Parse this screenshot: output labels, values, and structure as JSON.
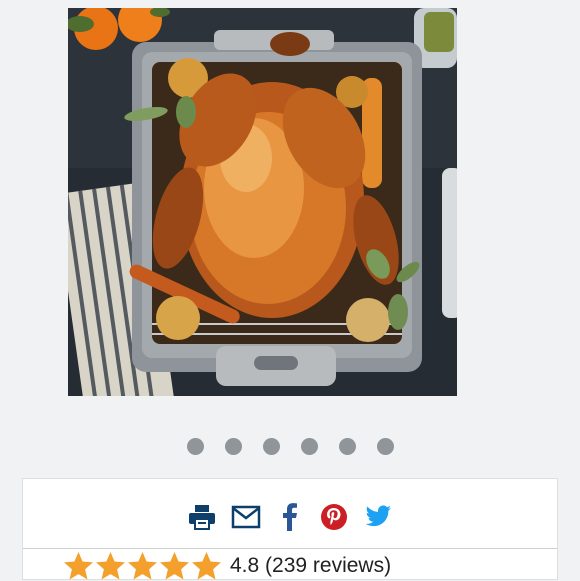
{
  "photo": {
    "alt": "Roasted turkey with vegetables in a roasting pan"
  },
  "carousel": {
    "dot_count": 6,
    "dot_color": "#8f9598"
  },
  "share": {
    "icons": [
      "print-icon",
      "email-icon",
      "facebook-icon",
      "pinterest-icon",
      "twitter-icon"
    ],
    "colors": {
      "print": "#0e3f6b",
      "email": "#0e3f6b",
      "facebook": "#2b5796",
      "pinterest": "#cc1f25",
      "twitter": "#1da1f2"
    }
  },
  "rating": {
    "stars": 5,
    "star_color": "#f3a12c",
    "score": "4.8",
    "reviews": "(239 reviews)"
  }
}
